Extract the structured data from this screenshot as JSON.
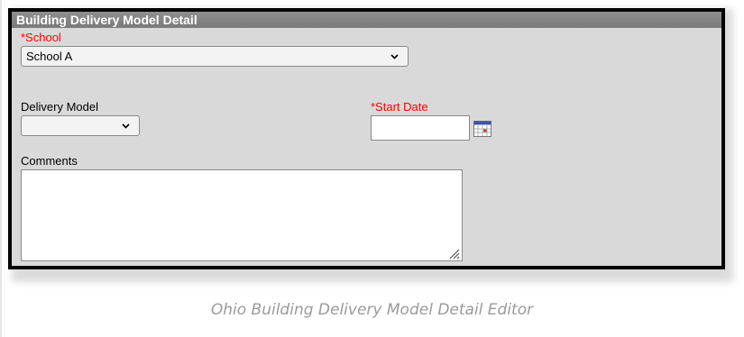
{
  "panel": {
    "title": "Building Delivery Model Detail"
  },
  "form": {
    "school": {
      "label": "*School",
      "value": "School A"
    },
    "delivery_model": {
      "label": "Delivery Model",
      "value": ""
    },
    "start_date": {
      "label": "*Start Date",
      "value": ""
    },
    "comments": {
      "label": "Comments",
      "value": ""
    }
  },
  "caption": "Ohio Building Delivery Model Detail Editor",
  "colors": {
    "required_label": "#ff0000",
    "header_bg": "#808080",
    "panel_bg": "#d9d9d9",
    "border": "#000000"
  },
  "icons": [
    "calendar-icon",
    "chevron-down-icon",
    "resize-grip-icon"
  ]
}
